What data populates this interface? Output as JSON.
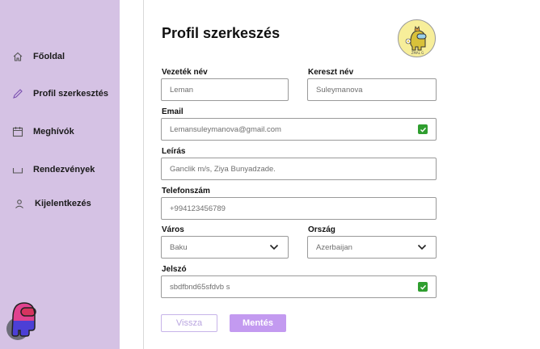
{
  "sidebar": {
    "items": [
      {
        "label": "Főoldal",
        "icon": "home-icon"
      },
      {
        "label": "Profil szerkesztés",
        "icon": "pencil-icon"
      },
      {
        "label": "Meghívók",
        "icon": "calendar-icon"
      },
      {
        "label": "Rendezvények",
        "icon": "tray-icon"
      },
      {
        "label": "Kijelentkezés",
        "icon": "user-icon"
      }
    ]
  },
  "page": {
    "title": "Profil szerkeszés",
    "profile_caption": "ZMAL G"
  },
  "form": {
    "last_name": {
      "label": "Vezeték név",
      "value": "Leman"
    },
    "first_name": {
      "label": "Kereszt név",
      "value": "Suleymanova"
    },
    "email": {
      "label": "Email",
      "value": "Lemansuleymanova@gmail.com"
    },
    "description": {
      "label": "Leírás",
      "value": "Ganclik m/s, Ziya Bunyadzade."
    },
    "phone": {
      "label": "Telefonszám",
      "value": "+994123456789"
    },
    "city": {
      "label": "Város",
      "value": "Baku"
    },
    "country": {
      "label": "Ország",
      "value": "Azerbaijan"
    },
    "password": {
      "label": "Jelszó",
      "value": "sbdfbnd65sfdvb s"
    }
  },
  "buttons": {
    "back": "Vissza",
    "save": "Mentés"
  },
  "colors": {
    "sidebar_bg": "#d5c2e4",
    "accent": "#c39af0",
    "check": "#2f9e2f"
  }
}
